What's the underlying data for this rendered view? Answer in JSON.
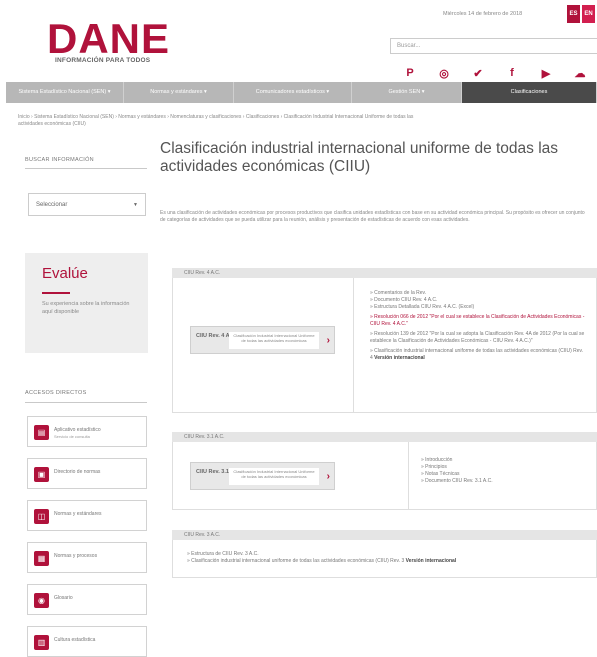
{
  "header": {
    "logo": "DANE",
    "tagline": "INFORMACIÓN PARA TODOS",
    "date": "Miércoles 14 de febrero de 2018",
    "lang_es": "ES",
    "lang_en": "EN",
    "search_placeholder": "Buscar...",
    "social": [
      {
        "icon": "pinterest-icon",
        "glyph": "P"
      },
      {
        "icon": "instagram-icon",
        "glyph": "◎"
      },
      {
        "icon": "twitter-icon",
        "glyph": "✔"
      },
      {
        "icon": "facebook-icon",
        "glyph": "f"
      },
      {
        "icon": "youtube-icon",
        "glyph": "▶"
      },
      {
        "icon": "cloud-icon",
        "glyph": "☁"
      },
      {
        "icon": "rss-icon",
        "glyph": "■"
      }
    ]
  },
  "nav": [
    {
      "label": "Sistema Estadístico Nacional (SEN) ▾",
      "active": false
    },
    {
      "label": "Normas y estándares ▾",
      "active": false
    },
    {
      "label": "Comunicadores estadísticos ▾",
      "active": false
    },
    {
      "label": "Gestión SEN ▾",
      "active": false
    },
    {
      "label": "Clasificaciones",
      "active": true
    }
  ],
  "breadcrumb": "Inicio › Sistema Estadístico Nacional (SEN) › Normas y estándares › Nomenclaturas y clasificaciones › Clasificaciones › Clasificación Industrial Internacional Uniforme de todas las actividades económicas (CIIU)",
  "sidebar": {
    "search_heading": "BUSCAR INFORMACIÓN",
    "select_value": "Seleccionar",
    "eval_title": "Evalúe",
    "eval_text": "Su experiencia sobre la información aquí disponible",
    "access_heading": "ACCESOS DIRECTOS",
    "access": [
      {
        "label": "Aplicativo estadístico",
        "sub": "Servicio de consulta"
      },
      {
        "label": "Directorio de normas",
        "sub": ""
      },
      {
        "label": "Normas y estándares",
        "sub": ""
      },
      {
        "label": "Normas y procesos",
        "sub": ""
      },
      {
        "label": "Glosario",
        "sub": ""
      },
      {
        "label": "Cultura estadística",
        "sub": ""
      }
    ]
  },
  "main": {
    "title": "Clasificación industrial internacional uniforme de todas las actividades económicas (CIIU)",
    "intro": "Es una clasificación de actividades económicas por procesos productivos que clasifica unidades estadísticas con base en su actividad económica principal. Su propósito es ofrecer un conjunto de categorías de actividades que se pueda utilizar para la reunión, análisis y presentación de estadísticas de acuerdo con esas actividades.",
    "sections": [
      {
        "heading": "CIIU Rev. 4 A.C.",
        "card_label": "CIIU Rev. 4 A.C.",
        "card_desc": "Clasificación Industrial Internacional Uniforme de todas las actividades económicas",
        "links": [
          {
            "text": "» Comentarios de la Rev.",
            "red": false
          },
          {
            "text": "» Documento CIIU Rev. 4 A.C.",
            "red": false
          },
          {
            "text": "» Estructura Detallada CIIU Rev. 4 A.C. (Excel)",
            "red": false
          },
          {
            "text": "» Resolución 066 de 2012 \"Por el cual se establece la Clasificación de Actividades Económicas - CIIU Rev. 4 A.C.\"",
            "red": true
          },
          {
            "text": "» Resolución 139 de 2012 \"Por la cual se adopta la Clasificación Rev. 4A de 2012 (Por la cual se establece la Clasificación de Actividades Económicas - CIIU Rev. 4 A.C.)\"",
            "red": false
          },
          {
            "text": "» Clasificación industrial internacional uniforme de todas las actividades económicas (CIIU) Rev. 4",
            "red": false,
            "bold": "Versión internacional"
          }
        ]
      },
      {
        "heading": "CIIU Rev. 3.1 A.C.",
        "card_label": "CIIU Rev. 3.1 A.C.",
        "card_desc": "Clasificación Industrial Internacional Uniforme de todas las actividades económicas",
        "links": [
          {
            "text": "» Introducción",
            "red": false
          },
          {
            "text": "» Principios",
            "red": false
          },
          {
            "text": "» Notas Técnicas",
            "red": false
          },
          {
            "text": "» Documento CIIU Rev. 3.1 A.C.",
            "red": false
          }
        ]
      },
      {
        "heading": "CIIU Rev. 3 A.C.",
        "links": [
          {
            "text": "» Estructura de CIIU Rev. 3 A.C.",
            "red": false
          },
          {
            "text": "» Clasificación industrial internacional uniforme de todas las actividades económicas (CIIU) Rev. 3",
            "red": false,
            "bold": "Versión internacional"
          }
        ]
      }
    ]
  }
}
